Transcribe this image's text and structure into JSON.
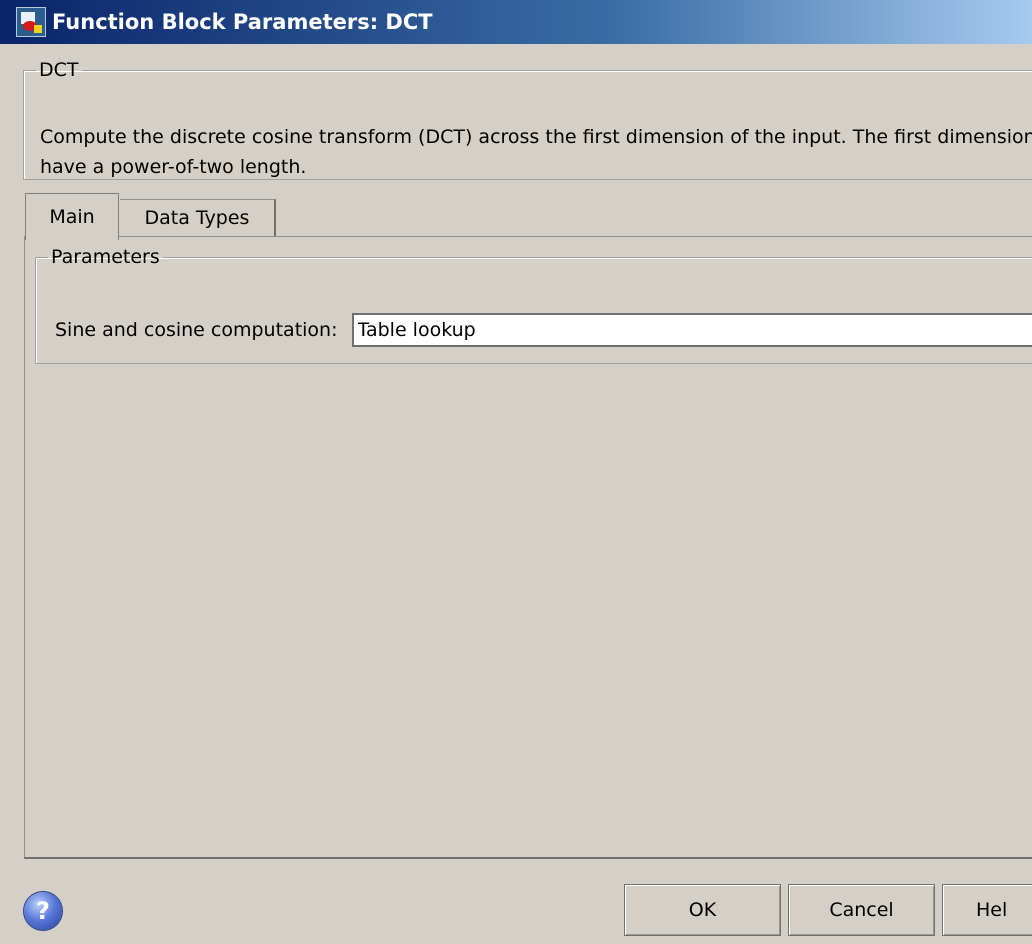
{
  "window": {
    "title": "Function Block Parameters: DCT"
  },
  "dct_group": {
    "legend": "DCT",
    "description_line1": "Compute the discrete cosine transform (DCT) across the first dimension of the input. The first dimension",
    "description_line2": "have a power-of-two length."
  },
  "tabs": [
    {
      "label": "Main",
      "selected": true
    },
    {
      "label": "Data Types",
      "selected": false
    }
  ],
  "parameters": {
    "legend": "Parameters",
    "sine_cosine_label": "Sine and cosine computation:",
    "sine_cosine_value": "Table lookup"
  },
  "buttons": {
    "help_icon": "?",
    "ok": "OK",
    "cancel": "Cancel",
    "help": "Hel"
  },
  "icons": {
    "title": "simulink-block-icon",
    "help": "help-question-icon"
  }
}
